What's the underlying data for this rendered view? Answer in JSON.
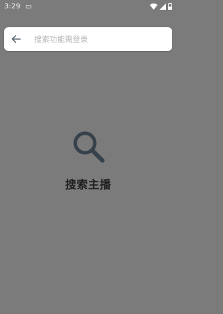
{
  "status_bar": {
    "time": "3:29",
    "icons": [
      "notification-icon",
      "wifi-icon",
      "signal-icon",
      "battery-icon"
    ]
  },
  "search": {
    "placeholder": "搜索功能需登录",
    "value": "",
    "back_icon": "arrow-left-icon"
  },
  "empty_state": {
    "icon": "search-icon",
    "message": "搜索主播"
  },
  "colors": {
    "background": "#7b7b7b",
    "search_bar": "#ffffff",
    "placeholder": "#b3b3b3",
    "icon": "#37414b",
    "text": "#1f1f1f"
  }
}
